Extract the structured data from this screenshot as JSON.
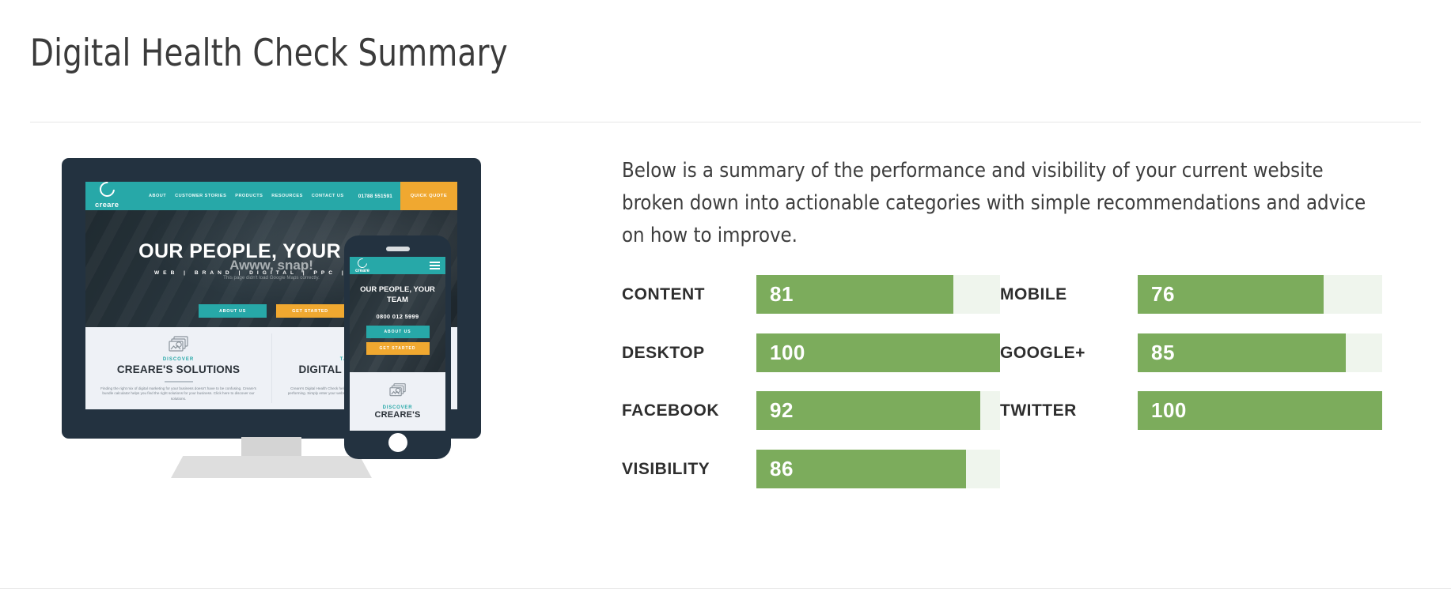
{
  "page": {
    "title": "Digital Health Check Summary",
    "intro": "Below is a summary of the performance and visibility of your current website broken down into actionable categories with simple recommendations and advice on how to improve."
  },
  "colors": {
    "bar_fill": "#7cac5c",
    "bar_track": "#eff5ed",
    "brand_teal": "#27a8a8",
    "brand_amber": "#f0a830",
    "device_shell": "#233240",
    "value_text": "#ffffff"
  },
  "chart_data": {
    "type": "bar",
    "title": "Digital Health Check Summary",
    "orientation": "horizontal",
    "xlabel": "",
    "ylabel": "",
    "ylim": [
      0,
      100
    ],
    "max_value": 100,
    "grid": false,
    "legend": "none",
    "layout": "two-column",
    "categories": [
      "CONTENT",
      "DESKTOP",
      "FACEBOOK",
      "VISIBILITY",
      "MOBILE",
      "GOOGLE+",
      "TWITTER"
    ],
    "values": [
      81,
      100,
      92,
      86,
      76,
      85,
      100
    ],
    "columns": {
      "left": {
        "categories": [
          "CONTENT",
          "DESKTOP",
          "FACEBOOK",
          "VISIBILITY"
        ],
        "values": [
          81,
          100,
          92,
          86
        ]
      },
      "right": {
        "categories": [
          "MOBILE",
          "GOOGLE+",
          "TWITTER"
        ],
        "values": [
          76,
          85,
          100
        ]
      }
    }
  },
  "scores": {
    "left": [
      {
        "label": "CONTENT",
        "value": 81,
        "display": "81",
        "pct": 81
      },
      {
        "label": "DESKTOP",
        "value": 100,
        "display": "100",
        "pct": 100
      },
      {
        "label": "FACEBOOK",
        "value": 92,
        "display": "92",
        "pct": 92
      },
      {
        "label": "VISIBILITY",
        "value": 86,
        "display": "86",
        "pct": 86
      }
    ],
    "right": [
      {
        "label": "MOBILE",
        "value": 76,
        "display": "76",
        "pct": 76
      },
      {
        "label": "GOOGLE+",
        "value": 85,
        "display": "85",
        "pct": 85
      },
      {
        "label": "TWITTER",
        "value": 100,
        "display": "100",
        "pct": 100
      }
    ]
  },
  "mockup": {
    "desktop": {
      "logo_word": "creare",
      "nav_links": [
        "ABOUT",
        "CUSTOMER STORIES",
        "PRODUCTS",
        "RESOURCES",
        "CONTACT US"
      ],
      "phone": "01788 551591",
      "quote_button": "QUICK QUOTE",
      "hero_title": "OUR PEOPLE, YOUR TEAM",
      "hero_sub": "WEB  |  BRAND  |  DIGITAL  |  PPC  |  VIDEO",
      "hero_overlay_title": "Awww, snap!",
      "hero_overlay_sub": "This page didn't load Google Maps correctly.",
      "hero_button_primary": "ABOUT US",
      "hero_button_secondary": "GET STARTED",
      "cards": [
        {
          "kicker": "DISCOVER",
          "title": "CREARE'S SOLUTIONS",
          "body": "Finding the right mix of digital marketing for your business doesn't have to be confusing. Creare's bundle calculator helps you find the right solutions for your business. Click here to discover our solutions."
        },
        {
          "kicker": "TAKE OUR FREE",
          "title": "DIGITAL HEALTH CHECK",
          "body": "Creare's Digital Health Check helps you discover how your website and online presence are performing. Simply enter your website's URL for your free report, then discover how to improve."
        }
      ]
    },
    "mobile": {
      "logo_word": "creare",
      "menu_icon": "hamburger-icon",
      "hero_title": "OUR PEOPLE, YOUR TEAM",
      "phone": "0800 012 5999",
      "button_primary": "ABOUT US",
      "button_secondary": "GET STARTED",
      "card_kicker": "DISCOVER",
      "card_title": "CREARE'S"
    }
  }
}
